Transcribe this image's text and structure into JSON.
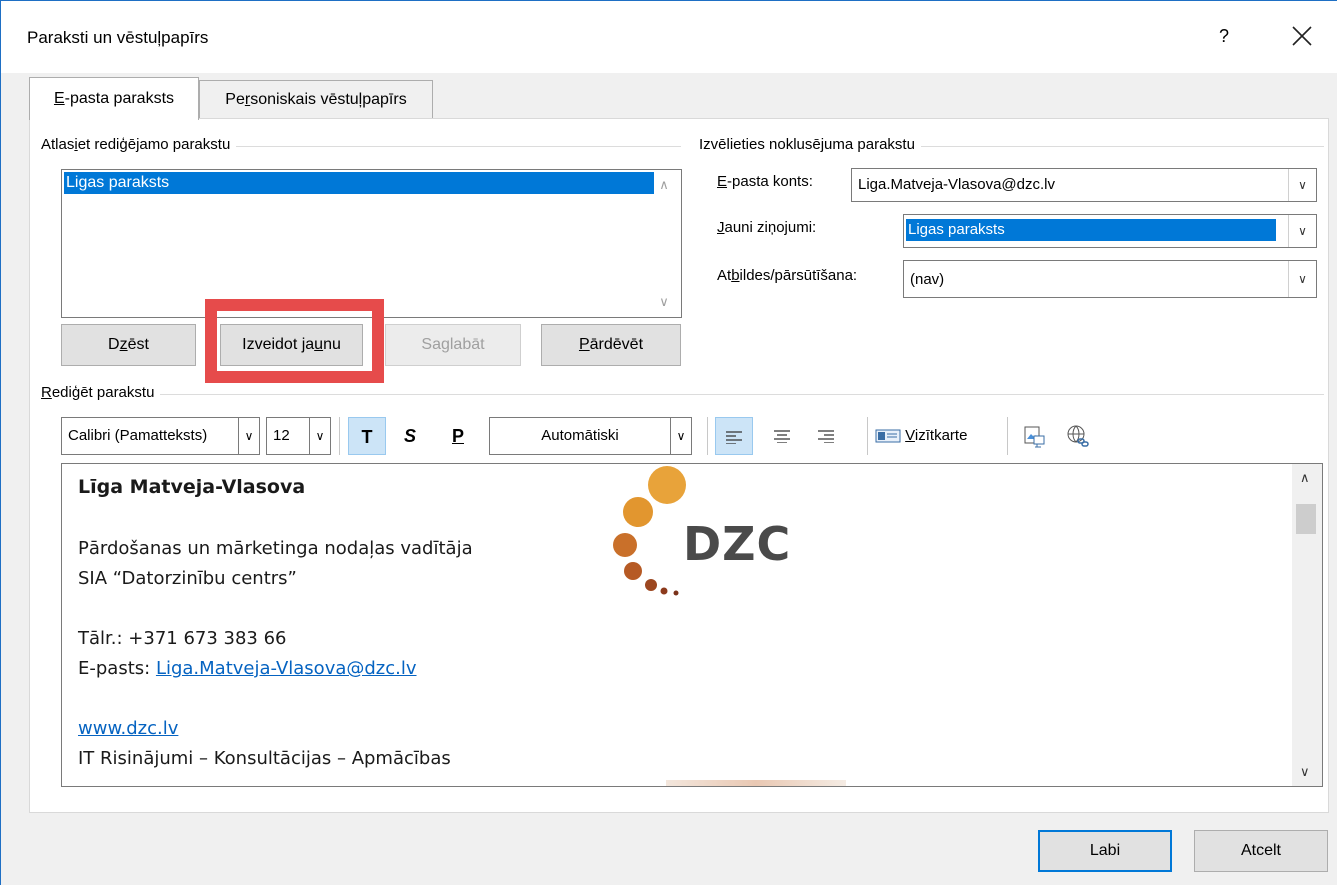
{
  "window": {
    "title": "Paraksti un vēstuļpapīrs",
    "help": "?"
  },
  "tabs": [
    {
      "label_pre": "",
      "label_key": "E",
      "label_post": "-pasta paraksts"
    },
    {
      "label_pre": "Pe",
      "label_key": "r",
      "label_post": "soniskais vēstuļpapīrs"
    }
  ],
  "select_section": {
    "label_pre": "Atlas",
    "label_key": "i",
    "label_post": "et rediģējamo parakstu",
    "items": [
      "Ligas paraksts"
    ],
    "buttons": {
      "delete": {
        "pre": "D",
        "key": "z",
        "post": "ēst"
      },
      "new": {
        "pre": "Izveidot ja",
        "key": "u",
        "post": "nu"
      },
      "save": "Saglabāt",
      "rename": {
        "pre": "",
        "key": "P",
        "post": "ārdēvēt"
      }
    }
  },
  "default_section": {
    "label": "Izvēlieties noklusējuma parakstu",
    "email_account_label": {
      "pre": "",
      "key": "E",
      "post": "-pasta konts:"
    },
    "email_account_value": "Liga.Matveja-Vlasova@dzc.lv",
    "new_messages_label": {
      "pre": "",
      "key": "J",
      "post": "auni ziņojumi:"
    },
    "new_messages_value": "Ligas paraksts",
    "replies_label": {
      "pre": "At",
      "key": "b",
      "post": "ildes/pārsūtīšana:"
    },
    "replies_value": "(nav)"
  },
  "edit_section": {
    "label_pre": "",
    "label_key": "R",
    "label_post": "ediģēt parakstu",
    "font": "Calibri (Pamatteksts)",
    "size": "12",
    "bold": "T",
    "italic": "S",
    "underline": "P",
    "color": "Automātiski",
    "business_card": {
      "pre": "",
      "key": "V",
      "post": "izītkarte"
    }
  },
  "signature": {
    "name": "Līga Matveja-Vlasova",
    "position": "Pārdošanas un mārketinga nodaļas vadītāja",
    "company": "SIA “Datorzinību centrs”",
    "phone": "Tālr.: +371 673 383 66",
    "email_prefix": "E-pasts: ",
    "email": "Liga.Matveja-Vlasova@dzc.lv",
    "website": "www.dzc.lv",
    "tagline": "IT Risinājumi – Konsultācijas – Apmācības",
    "logo_text": "DZC"
  },
  "footer": {
    "ok": "Labi",
    "cancel": "Atcelt"
  },
  "colors": {
    "accent": "#0078d7",
    "highlight_box": "#e64b4b",
    "link": "#0563c1",
    "logo_orange": "#e8a33a",
    "logo_brown": "#8c3a1c"
  }
}
